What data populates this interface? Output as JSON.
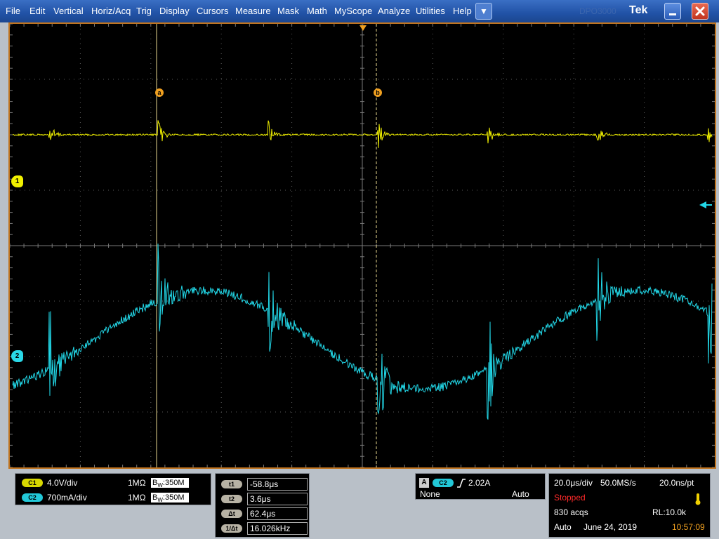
{
  "menubar": {
    "items": [
      "File",
      "Edit",
      "Vertical",
      "Horiz/Acq",
      "Trig",
      "Display",
      "Cursors",
      "Measure",
      "Mask",
      "Math",
      "MyScope",
      "Analyze",
      "Utilities",
      "Help"
    ],
    "dropdown_icon": "▼",
    "brand": "Tek",
    "brand_ghost": "DPO3000",
    "minimize_icon": "minimize-icon",
    "close_icon": "close-icon"
  },
  "screen": {
    "ch1_marker": "1",
    "ch2_marker": "2",
    "cursor_a_label": "a",
    "cursor_b_label": "b",
    "colors": {
      "ch1": "#f0f000",
      "ch2": "#22d8e8",
      "grid": "#5a5a5a",
      "cursor": "#f0d060",
      "border": "#c07420"
    }
  },
  "channels": [
    {
      "name": "C1",
      "scale": "4.0V/div",
      "impedance": "1MΩ",
      "bw_prefix": "B",
      "bw_sub": "W",
      "bandwidth": ":350M"
    },
    {
      "name": "C2",
      "scale": "700mA/div",
      "impedance": "1MΩ",
      "bw_prefix": "B",
      "bw_sub": "W",
      "bandwidth": ":350M"
    }
  ],
  "cursors": [
    {
      "label": "t1",
      "value": "-58.8μs"
    },
    {
      "label": "t2",
      "value": "3.6μs"
    },
    {
      "label": "Δt",
      "value": "62.4μs"
    },
    {
      "label": "1/Δt",
      "value": "16.026kHz"
    }
  ],
  "trigger": {
    "tag": "A",
    "source": "C2",
    "slope_icon": "rising-edge-icon",
    "level": "2.02A",
    "coupling": "None",
    "mode": "Auto"
  },
  "horizontal": {
    "timebase": "20.0μs/div",
    "sample_rate": "50.0MS/s",
    "resolution": "20.0ns/pt",
    "status": "Stopped",
    "acqs": "830 acqs",
    "record_length": "RL:10.0k",
    "mode": "Auto",
    "date": "June 24, 2019",
    "time": "10:57:09"
  }
}
